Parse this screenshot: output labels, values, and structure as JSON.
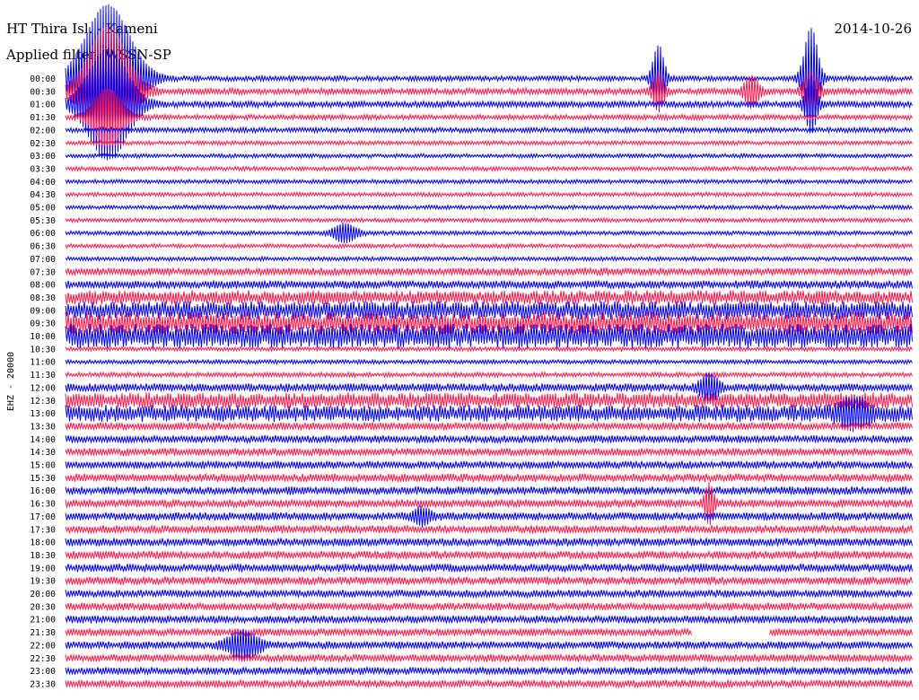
{
  "header": {
    "station": "HT Thira Isl. - Kameni",
    "date": "2014-10-26",
    "filter_label": "Applied filter: WSSN-SP"
  },
  "side_label": "EHZ - 20000",
  "chart_data": {
    "type": "helicorder",
    "title": "HT Thira Isl. - Kameni",
    "date": "2014-10-26",
    "filter": "WSSN-SP",
    "channel_label": "EHZ - 20000",
    "row_interval_minutes": 30,
    "tick_labels": [
      "00:00",
      "00:30",
      "01:00",
      "01:30",
      "02:00",
      "02:30",
      "03:00",
      "03:30",
      "04:00",
      "04:30",
      "05:00",
      "05:30",
      "06:00",
      "06:30",
      "07:00",
      "07:30",
      "08:00",
      "08:30",
      "09:00",
      "09:30",
      "10:00",
      "10:30",
      "11:00",
      "11:30",
      "12:00",
      "12:30",
      "13:00",
      "13:30",
      "14:00",
      "14:30",
      "15:00",
      "15:30",
      "16:00",
      "16:30",
      "17:00",
      "17:30",
      "18:00",
      "18:30",
      "19:00",
      "19:30",
      "20:00",
      "20:30",
      "21:00",
      "21:30",
      "22:00",
      "22:30",
      "23:00",
      "23:30"
    ],
    "colors": {
      "even_rows": "#0000ee",
      "odd_rows": "#ff1a4b"
    },
    "row_noise_level": [
      2.0,
      2.5,
      2.5,
      2.0,
      2.0,
      1.6,
      1.6,
      1.6,
      1.6,
      1.6,
      1.6,
      1.6,
      1.6,
      1.6,
      1.6,
      3.0,
      3.2,
      5.5,
      7.0,
      8.5,
      9.5,
      1.6,
      1.6,
      1.8,
      3.2,
      6.0,
      6.5,
      3.0,
      3.0,
      3.0,
      3.0,
      3.2,
      3.2,
      3.2,
      3.2,
      3.2,
      3.2,
      3.2,
      3.2,
      3.2,
      3.0,
      3.0,
      3.0,
      3.0,
      3.0,
      3.0,
      3.0,
      3.0
    ],
    "events": [
      {
        "row": 0,
        "x": 0.05,
        "amp": 80,
        "width": 0.035
      },
      {
        "row": 1,
        "x": 0.05,
        "amp": 70,
        "width": 0.03
      },
      {
        "row": 2,
        "x": 0.05,
        "amp": 60,
        "width": 0.03
      },
      {
        "row": 3,
        "x": 0.05,
        "amp": 30,
        "width": 0.02
      },
      {
        "row": 0,
        "x": 0.7,
        "amp": 36,
        "width": 0.008
      },
      {
        "row": 0,
        "x": 0.88,
        "amp": 55,
        "width": 0.01
      },
      {
        "row": 1,
        "x": 0.7,
        "amp": 18,
        "width": 0.008
      },
      {
        "row": 1,
        "x": 0.81,
        "amp": 16,
        "width": 0.01
      },
      {
        "row": 1,
        "x": 0.88,
        "amp": 20,
        "width": 0.01
      },
      {
        "row": 2,
        "x": 0.88,
        "amp": 30,
        "width": 0.008
      },
      {
        "row": 12,
        "x": 0.33,
        "amp": 10,
        "width": 0.015
      },
      {
        "row": 24,
        "x": 0.76,
        "amp": 14,
        "width": 0.012
      },
      {
        "row": 26,
        "x": 0.93,
        "amp": 12,
        "width": 0.02
      },
      {
        "row": 33,
        "x": 0.76,
        "amp": 20,
        "width": 0.006
      },
      {
        "row": 34,
        "x": 0.42,
        "amp": 8,
        "width": 0.012
      },
      {
        "row": 44,
        "x": 0.21,
        "amp": 14,
        "width": 0.02
      }
    ],
    "gaps": [
      {
        "row": 43,
        "x_start": 0.74,
        "x_end": 0.83
      }
    ]
  }
}
